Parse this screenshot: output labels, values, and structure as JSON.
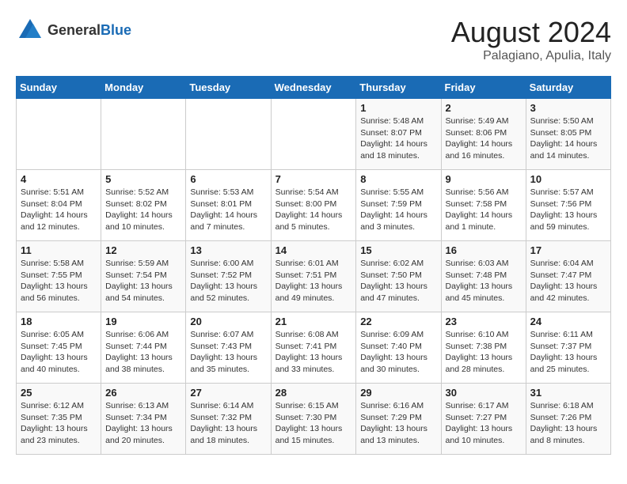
{
  "header": {
    "logo_general": "General",
    "logo_blue": "Blue",
    "title": "August 2024",
    "subtitle": "Palagiano, Apulia, Italy"
  },
  "days_of_week": [
    "Sunday",
    "Monday",
    "Tuesday",
    "Wednesday",
    "Thursday",
    "Friday",
    "Saturday"
  ],
  "weeks": [
    [
      {
        "day": "",
        "info": ""
      },
      {
        "day": "",
        "info": ""
      },
      {
        "day": "",
        "info": ""
      },
      {
        "day": "",
        "info": ""
      },
      {
        "day": "1",
        "info": "Sunrise: 5:48 AM\nSunset: 8:07 PM\nDaylight: 14 hours and 18 minutes."
      },
      {
        "day": "2",
        "info": "Sunrise: 5:49 AM\nSunset: 8:06 PM\nDaylight: 14 hours and 16 minutes."
      },
      {
        "day": "3",
        "info": "Sunrise: 5:50 AM\nSunset: 8:05 PM\nDaylight: 14 hours and 14 minutes."
      }
    ],
    [
      {
        "day": "4",
        "info": "Sunrise: 5:51 AM\nSunset: 8:04 PM\nDaylight: 14 hours and 12 minutes."
      },
      {
        "day": "5",
        "info": "Sunrise: 5:52 AM\nSunset: 8:02 PM\nDaylight: 14 hours and 10 minutes."
      },
      {
        "day": "6",
        "info": "Sunrise: 5:53 AM\nSunset: 8:01 PM\nDaylight: 14 hours and 7 minutes."
      },
      {
        "day": "7",
        "info": "Sunrise: 5:54 AM\nSunset: 8:00 PM\nDaylight: 14 hours and 5 minutes."
      },
      {
        "day": "8",
        "info": "Sunrise: 5:55 AM\nSunset: 7:59 PM\nDaylight: 14 hours and 3 minutes."
      },
      {
        "day": "9",
        "info": "Sunrise: 5:56 AM\nSunset: 7:58 PM\nDaylight: 14 hours and 1 minute."
      },
      {
        "day": "10",
        "info": "Sunrise: 5:57 AM\nSunset: 7:56 PM\nDaylight: 13 hours and 59 minutes."
      }
    ],
    [
      {
        "day": "11",
        "info": "Sunrise: 5:58 AM\nSunset: 7:55 PM\nDaylight: 13 hours and 56 minutes."
      },
      {
        "day": "12",
        "info": "Sunrise: 5:59 AM\nSunset: 7:54 PM\nDaylight: 13 hours and 54 minutes."
      },
      {
        "day": "13",
        "info": "Sunrise: 6:00 AM\nSunset: 7:52 PM\nDaylight: 13 hours and 52 minutes."
      },
      {
        "day": "14",
        "info": "Sunrise: 6:01 AM\nSunset: 7:51 PM\nDaylight: 13 hours and 49 minutes."
      },
      {
        "day": "15",
        "info": "Sunrise: 6:02 AM\nSunset: 7:50 PM\nDaylight: 13 hours and 47 minutes."
      },
      {
        "day": "16",
        "info": "Sunrise: 6:03 AM\nSunset: 7:48 PM\nDaylight: 13 hours and 45 minutes."
      },
      {
        "day": "17",
        "info": "Sunrise: 6:04 AM\nSunset: 7:47 PM\nDaylight: 13 hours and 42 minutes."
      }
    ],
    [
      {
        "day": "18",
        "info": "Sunrise: 6:05 AM\nSunset: 7:45 PM\nDaylight: 13 hours and 40 minutes."
      },
      {
        "day": "19",
        "info": "Sunrise: 6:06 AM\nSunset: 7:44 PM\nDaylight: 13 hours and 38 minutes."
      },
      {
        "day": "20",
        "info": "Sunrise: 6:07 AM\nSunset: 7:43 PM\nDaylight: 13 hours and 35 minutes."
      },
      {
        "day": "21",
        "info": "Sunrise: 6:08 AM\nSunset: 7:41 PM\nDaylight: 13 hours and 33 minutes."
      },
      {
        "day": "22",
        "info": "Sunrise: 6:09 AM\nSunset: 7:40 PM\nDaylight: 13 hours and 30 minutes."
      },
      {
        "day": "23",
        "info": "Sunrise: 6:10 AM\nSunset: 7:38 PM\nDaylight: 13 hours and 28 minutes."
      },
      {
        "day": "24",
        "info": "Sunrise: 6:11 AM\nSunset: 7:37 PM\nDaylight: 13 hours and 25 minutes."
      }
    ],
    [
      {
        "day": "25",
        "info": "Sunrise: 6:12 AM\nSunset: 7:35 PM\nDaylight: 13 hours and 23 minutes."
      },
      {
        "day": "26",
        "info": "Sunrise: 6:13 AM\nSunset: 7:34 PM\nDaylight: 13 hours and 20 minutes."
      },
      {
        "day": "27",
        "info": "Sunrise: 6:14 AM\nSunset: 7:32 PM\nDaylight: 13 hours and 18 minutes."
      },
      {
        "day": "28",
        "info": "Sunrise: 6:15 AM\nSunset: 7:30 PM\nDaylight: 13 hours and 15 minutes."
      },
      {
        "day": "29",
        "info": "Sunrise: 6:16 AM\nSunset: 7:29 PM\nDaylight: 13 hours and 13 minutes."
      },
      {
        "day": "30",
        "info": "Sunrise: 6:17 AM\nSunset: 7:27 PM\nDaylight: 13 hours and 10 minutes."
      },
      {
        "day": "31",
        "info": "Sunrise: 6:18 AM\nSunset: 7:26 PM\nDaylight: 13 hours and 8 minutes."
      }
    ]
  ]
}
